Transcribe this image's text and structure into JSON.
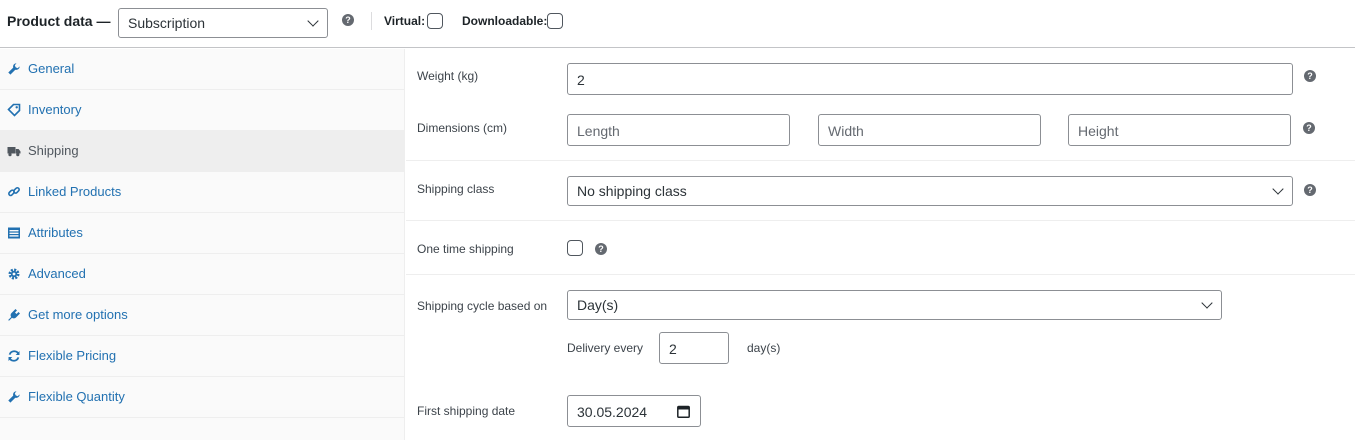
{
  "header": {
    "title": "Product data —",
    "product_type": "Subscription",
    "virtual_label": "Virtual:",
    "downloadable_label": "Downloadable:"
  },
  "sidebar": {
    "items": [
      {
        "label": "General",
        "icon": "wrench-icon"
      },
      {
        "label": "Inventory",
        "icon": "tag-icon"
      },
      {
        "label": "Shipping",
        "icon": "truck-icon",
        "active": true
      },
      {
        "label": "Linked Products",
        "icon": "link-icon"
      },
      {
        "label": "Attributes",
        "icon": "list-icon"
      },
      {
        "label": "Advanced",
        "icon": "gear-icon"
      },
      {
        "label": "Get more options",
        "icon": "plugin-icon"
      },
      {
        "label": "Flexible Pricing",
        "icon": "refresh-icon"
      },
      {
        "label": "Flexible Quantity",
        "icon": "wrench-icon"
      }
    ]
  },
  "shipping": {
    "weight": {
      "label": "Weight (kg)",
      "value": "2"
    },
    "dimensions": {
      "label": "Dimensions (cm)",
      "length_placeholder": "Length",
      "width_placeholder": "Width",
      "height_placeholder": "Height"
    },
    "shipping_class": {
      "label": "Shipping class",
      "value": "No shipping class"
    },
    "one_time_shipping": {
      "label": "One time shipping",
      "checked": false
    },
    "cycle": {
      "label": "Shipping cycle based on",
      "value": "Day(s)"
    },
    "delivery": {
      "label": "Delivery every",
      "value": "2",
      "unit": "day(s)"
    },
    "first_date": {
      "label": "First shipping date",
      "value": "30.05.2024"
    }
  },
  "colors": {
    "link": "#2271b1",
    "active_tab_bg": "#eeeeee",
    "sidebar_bg": "#fafafa",
    "border": "#8c8f94"
  }
}
